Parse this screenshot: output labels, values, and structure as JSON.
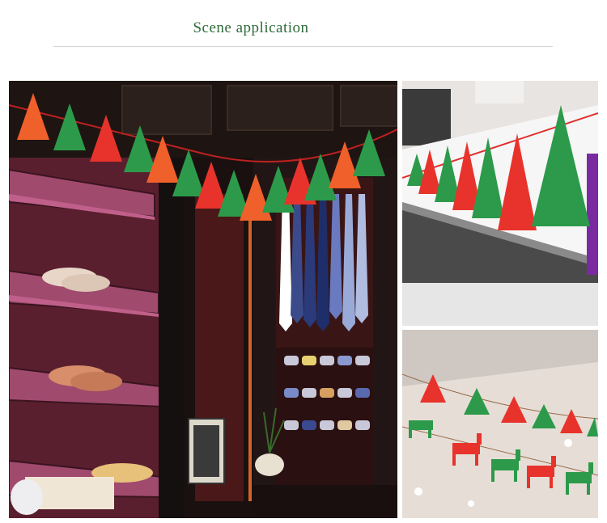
{
  "header": {
    "title": "Scene application"
  },
  "photos": [
    {
      "name": "shop-closet-garland-photo",
      "alt": "Felt Christmas tree garland hung across a shop's shoe and tie shelves"
    },
    {
      "name": "counter-garland-photo",
      "alt": "Felt Christmas tree garland on a white reception counter"
    },
    {
      "name": "ceiling-garland-photo",
      "alt": "Felt Christmas tree and reindeer garland under a ceiling"
    }
  ],
  "colors": {
    "title": "#2f6b3a",
    "felt_red": "#e8332c",
    "felt_green": "#2c9a4a",
    "felt_orange": "#f0602a"
  }
}
